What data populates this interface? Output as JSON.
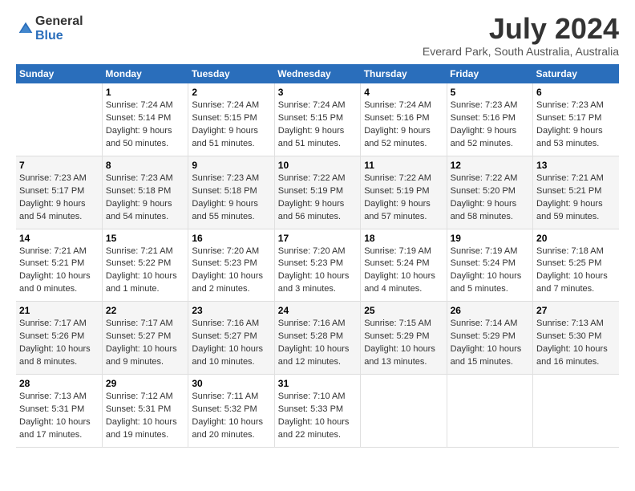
{
  "header": {
    "logo_general": "General",
    "logo_blue": "Blue",
    "title": "July 2024",
    "subtitle": "Everard Park, South Australia, Australia"
  },
  "columns": [
    "Sunday",
    "Monday",
    "Tuesday",
    "Wednesday",
    "Thursday",
    "Friday",
    "Saturday"
  ],
  "weeks": [
    [
      {
        "day": "",
        "info": ""
      },
      {
        "day": "1",
        "info": "Sunrise: 7:24 AM\nSunset: 5:14 PM\nDaylight: 9 hours\nand 50 minutes."
      },
      {
        "day": "2",
        "info": "Sunrise: 7:24 AM\nSunset: 5:15 PM\nDaylight: 9 hours\nand 51 minutes."
      },
      {
        "day": "3",
        "info": "Sunrise: 7:24 AM\nSunset: 5:15 PM\nDaylight: 9 hours\nand 51 minutes."
      },
      {
        "day": "4",
        "info": "Sunrise: 7:24 AM\nSunset: 5:16 PM\nDaylight: 9 hours\nand 52 minutes."
      },
      {
        "day": "5",
        "info": "Sunrise: 7:23 AM\nSunset: 5:16 PM\nDaylight: 9 hours\nand 52 minutes."
      },
      {
        "day": "6",
        "info": "Sunrise: 7:23 AM\nSunset: 5:17 PM\nDaylight: 9 hours\nand 53 minutes."
      }
    ],
    [
      {
        "day": "7",
        "info": "Sunrise: 7:23 AM\nSunset: 5:17 PM\nDaylight: 9 hours\nand 54 minutes."
      },
      {
        "day": "8",
        "info": "Sunrise: 7:23 AM\nSunset: 5:18 PM\nDaylight: 9 hours\nand 54 minutes."
      },
      {
        "day": "9",
        "info": "Sunrise: 7:23 AM\nSunset: 5:18 PM\nDaylight: 9 hours\nand 55 minutes."
      },
      {
        "day": "10",
        "info": "Sunrise: 7:22 AM\nSunset: 5:19 PM\nDaylight: 9 hours\nand 56 minutes."
      },
      {
        "day": "11",
        "info": "Sunrise: 7:22 AM\nSunset: 5:19 PM\nDaylight: 9 hours\nand 57 minutes."
      },
      {
        "day": "12",
        "info": "Sunrise: 7:22 AM\nSunset: 5:20 PM\nDaylight: 9 hours\nand 58 minutes."
      },
      {
        "day": "13",
        "info": "Sunrise: 7:21 AM\nSunset: 5:21 PM\nDaylight: 9 hours\nand 59 minutes."
      }
    ],
    [
      {
        "day": "14",
        "info": "Sunrise: 7:21 AM\nSunset: 5:21 PM\nDaylight: 10 hours\nand 0 minutes."
      },
      {
        "day": "15",
        "info": "Sunrise: 7:21 AM\nSunset: 5:22 PM\nDaylight: 10 hours\nand 1 minute."
      },
      {
        "day": "16",
        "info": "Sunrise: 7:20 AM\nSunset: 5:23 PM\nDaylight: 10 hours\nand 2 minutes."
      },
      {
        "day": "17",
        "info": "Sunrise: 7:20 AM\nSunset: 5:23 PM\nDaylight: 10 hours\nand 3 minutes."
      },
      {
        "day": "18",
        "info": "Sunrise: 7:19 AM\nSunset: 5:24 PM\nDaylight: 10 hours\nand 4 minutes."
      },
      {
        "day": "19",
        "info": "Sunrise: 7:19 AM\nSunset: 5:24 PM\nDaylight: 10 hours\nand 5 minutes."
      },
      {
        "day": "20",
        "info": "Sunrise: 7:18 AM\nSunset: 5:25 PM\nDaylight: 10 hours\nand 7 minutes."
      }
    ],
    [
      {
        "day": "21",
        "info": "Sunrise: 7:17 AM\nSunset: 5:26 PM\nDaylight: 10 hours\nand 8 minutes."
      },
      {
        "day": "22",
        "info": "Sunrise: 7:17 AM\nSunset: 5:27 PM\nDaylight: 10 hours\nand 9 minutes."
      },
      {
        "day": "23",
        "info": "Sunrise: 7:16 AM\nSunset: 5:27 PM\nDaylight: 10 hours\nand 10 minutes."
      },
      {
        "day": "24",
        "info": "Sunrise: 7:16 AM\nSunset: 5:28 PM\nDaylight: 10 hours\nand 12 minutes."
      },
      {
        "day": "25",
        "info": "Sunrise: 7:15 AM\nSunset: 5:29 PM\nDaylight: 10 hours\nand 13 minutes."
      },
      {
        "day": "26",
        "info": "Sunrise: 7:14 AM\nSunset: 5:29 PM\nDaylight: 10 hours\nand 15 minutes."
      },
      {
        "day": "27",
        "info": "Sunrise: 7:13 AM\nSunset: 5:30 PM\nDaylight: 10 hours\nand 16 minutes."
      }
    ],
    [
      {
        "day": "28",
        "info": "Sunrise: 7:13 AM\nSunset: 5:31 PM\nDaylight: 10 hours\nand 17 minutes."
      },
      {
        "day": "29",
        "info": "Sunrise: 7:12 AM\nSunset: 5:31 PM\nDaylight: 10 hours\nand 19 minutes."
      },
      {
        "day": "30",
        "info": "Sunrise: 7:11 AM\nSunset: 5:32 PM\nDaylight: 10 hours\nand 20 minutes."
      },
      {
        "day": "31",
        "info": "Sunrise: 7:10 AM\nSunset: 5:33 PM\nDaylight: 10 hours\nand 22 minutes."
      },
      {
        "day": "",
        "info": ""
      },
      {
        "day": "",
        "info": ""
      },
      {
        "day": "",
        "info": ""
      }
    ]
  ]
}
